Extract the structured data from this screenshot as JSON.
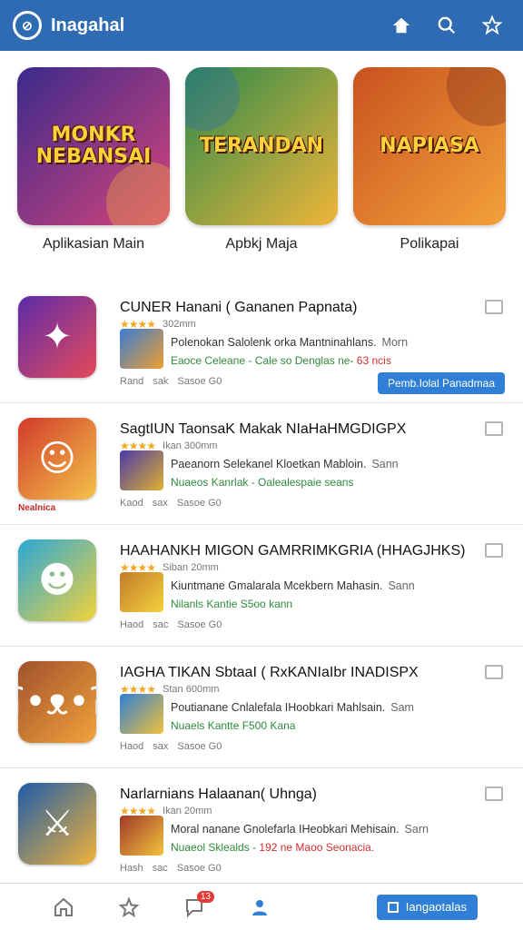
{
  "header": {
    "title": "Inagahal",
    "logo_text": "⊘",
    "bg": "#2f6bb3"
  },
  "featured": [
    {
      "title": "MONKR NEBANSAI",
      "label": "Aplikasian Main",
      "c1": "#3b2a8c",
      "c2": "#d8447a"
    },
    {
      "title": "TERANDAN",
      "label": "Apbkj Maja",
      "c1": "#2b8a4a",
      "c2": "#f0b53a"
    },
    {
      "title": "NAPIASA",
      "label": "Polikapai",
      "c1": "#c9521f",
      "c2": "#f3a13a"
    }
  ],
  "items": [
    {
      "title": "CUNER Hanani ( Gananen Papnata)",
      "rating": "★★★★",
      "size": "302mm",
      "desc": "Polenokan  Salolenk orka Mantninahlans.",
      "extra": "Morn",
      "tags": "Eaoce Celeane - Cale so Denglas ne-",
      "tags_red": "63 ncis",
      "stat1": "Rand",
      "stat2": "sak",
      "stat3": "Sasoe G0",
      "button": "Pemb.Iolal Panadmaa",
      "tag": "",
      "c1": "#5b2aa8",
      "c2": "#e64a5a"
    },
    {
      "title": "SagtIUN TaonsaK Makak NIaHaHMGDIGPX",
      "rating": "★★★★",
      "size": "Ikan 300mm",
      "desc": "Paeanorn Selekanel Kloetkan Mabloin.",
      "extra": "Sann",
      "tags": "Nuaeos Kanrlak - Oalealespaie seans",
      "tags_red": "",
      "stat1": "Kaod",
      "stat2": "sax",
      "stat3": "Sasoe G0",
      "button": "",
      "tag": "Nealnica",
      "c1": "#d23a2a",
      "c2": "#f4c34a"
    },
    {
      "title": "HAAHANKH MIGON GAMRRIMKGRIA (HHAGJHKS)",
      "rating": "★★★★",
      "size": "Siban 20mm",
      "desc": "Kiuntmane Gmalarala Mcekbern Mahasin.",
      "extra": "Sann",
      "tags": "Nilanls Kantie S5oo kann",
      "tags_red": "",
      "stat1": "Haod",
      "stat2": "sac",
      "stat3": "Sasoe G0",
      "button": "",
      "tag": "",
      "c1": "#2aa8d8",
      "c2": "#f2d23a"
    },
    {
      "title": "IAGHA TIKAN SbtaaI ( RxKANIaIbr INADISPX",
      "rating": "★★★★",
      "size": "Stan 600mm",
      "desc": "Poutianane Cnlalefala IHoobkari Mahlsain.",
      "extra": "Sam",
      "tags": "Nuaels Kantte F500 Kana",
      "tags_red": "",
      "stat1": "Haod",
      "stat2": "sax",
      "stat3": "Sasoe G0",
      "button": "",
      "tag": "",
      "c1": "#a0522d",
      "c2": "#f2a23a"
    },
    {
      "title": "Narlarnians Halaanan( Uhnga)",
      "rating": "★★★★",
      "size": "Ikan 20mm",
      "desc": "Moral nanane Gnolefarla IHeobkari Mehisain.",
      "extra": "Sarn",
      "tags": "Nuaeol Sklealds - ",
      "tags_red": "192 ne Maoo Seonacia.",
      "stat1": "Hash",
      "stat2": "sac",
      "stat3": "Sasoe G0",
      "button": "",
      "tag": "",
      "c1": "#1e5ca8",
      "c2": "#f2b33a"
    }
  ],
  "bottom": {
    "badge": "13",
    "button": "Iangaotalas"
  }
}
